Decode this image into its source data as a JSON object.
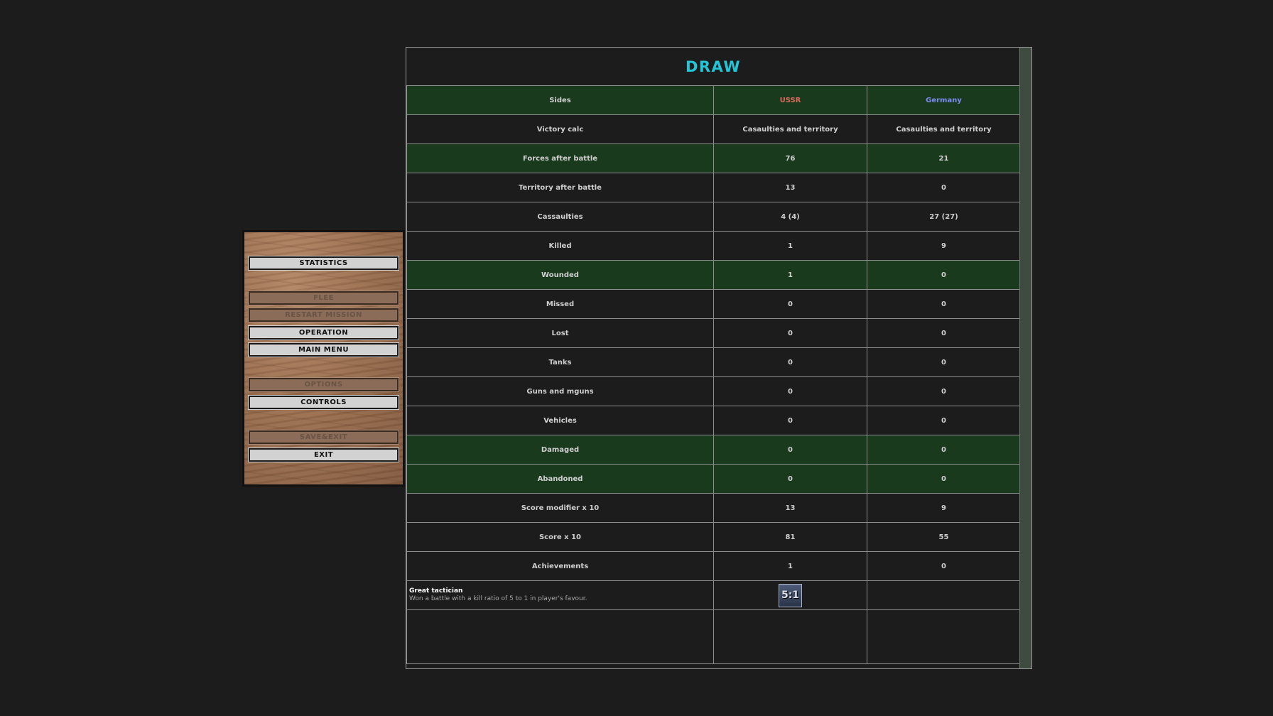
{
  "menu": {
    "statistics": "STATISTICS",
    "flee": "FLEE",
    "restart_mission": "RESTART MISSION",
    "operation": "OPERATION",
    "main_menu": "MAIN MENU",
    "options": "OPTIONS",
    "controls": "CONTROLS",
    "save_exit": "SAVE&EXIT",
    "exit": "EXIT"
  },
  "result": {
    "title": "DRAW"
  },
  "table": {
    "sides": {
      "label": "Sides",
      "ussr": "USSR",
      "germany": "Germany"
    },
    "rows": [
      {
        "label": "Victory calc",
        "ussr": "Casaulties and territory",
        "germany": "Casaulties and territory"
      },
      {
        "label": "Forces after battle",
        "ussr": "76",
        "germany": "21"
      },
      {
        "label": "Territory after battle",
        "ussr": "13",
        "germany": "0"
      },
      {
        "label": "Cassaulties",
        "ussr": "4 (4)",
        "germany": "27 (27)"
      },
      {
        "label": "Killed",
        "ussr": "1",
        "germany": "9"
      },
      {
        "label": "Wounded",
        "ussr": "1",
        "germany": "0"
      },
      {
        "label": "Missed",
        "ussr": "0",
        "germany": "0"
      },
      {
        "label": "Lost",
        "ussr": "0",
        "germany": "0"
      },
      {
        "label": "Tanks",
        "ussr": "0",
        "germany": "0"
      },
      {
        "label": "Guns and mguns",
        "ussr": "0",
        "germany": "0"
      },
      {
        "label": "Vehicles",
        "ussr": "0",
        "germany": "0"
      },
      {
        "label": "Damaged",
        "ussr": "0",
        "germany": "0"
      },
      {
        "label": "Abandoned",
        "ussr": "0",
        "germany": "0"
      },
      {
        "label": "Score modifier x 10",
        "ussr": "13",
        "germany": "9"
      },
      {
        "label": "Score x 10",
        "ussr": "81",
        "germany": "55"
      },
      {
        "label": "Achievements",
        "ussr": "1",
        "germany": "0"
      }
    ],
    "achievement": {
      "title": "Great tactician",
      "description": "Won a battle with a kill ratio of 5 to 1 in player's favour.",
      "badge": "5:1",
      "badge_icon": "achievement-badge-icon"
    }
  },
  "colors": {
    "title": "#22c6d6",
    "highlight_row": "#1a3a1e",
    "ussr": "#d86c5c",
    "germany": "#7b8cf0",
    "background": "#1c1c1c"
  }
}
